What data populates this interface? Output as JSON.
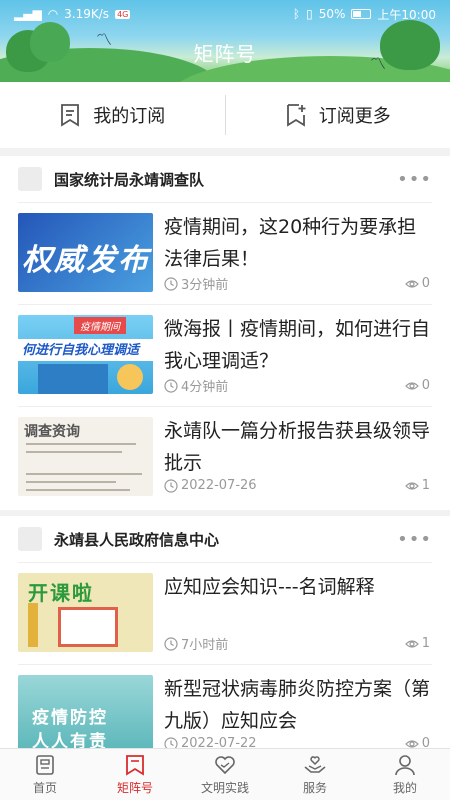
{
  "status_bar": {
    "speed": "3.19K/s",
    "net_badge": "4G",
    "battery": "50%",
    "time": "上午10:00"
  },
  "header": {
    "title": "矩阵号"
  },
  "subscribe": {
    "my_label": "我的订阅",
    "more_label": "订阅更多"
  },
  "sections": [
    {
      "title": "国家统计局永靖调查队",
      "items": [
        {
          "title": "疫情期间，这20种行为要承担法律后果！",
          "time": "3分钟前",
          "views": "0",
          "thumb_text": "权威发布"
        },
        {
          "title": "微海报丨疫情期间，如何进行自我心理调适？",
          "time": "4分钟前",
          "views": "0",
          "thumb_tag": "疫情期间",
          "thumb_text": "何进行自我心理调适"
        },
        {
          "title": "永靖队一篇分析报告获县级领导批示",
          "time": "2022-07-26",
          "views": "1",
          "thumb_text": "调查资询"
        }
      ]
    },
    {
      "title": "永靖县人民政府信息中心",
      "items": [
        {
          "title": "应知应会知识---名词解释",
          "time": "7小时前",
          "views": "1",
          "thumb_text": "开课啦"
        },
        {
          "title": "新型冠状病毒肺炎防控方案（第九版）应知应会",
          "time": "2022-07-22",
          "views": "0",
          "thumb_text_1": "疫情防控",
          "thumb_text_2": "人人有责"
        }
      ]
    }
  ],
  "nav": [
    {
      "label": "首页",
      "icon": "home-icon"
    },
    {
      "label": "矩阵号",
      "icon": "bookmark-icon"
    },
    {
      "label": "文明实践",
      "icon": "heart-icon"
    },
    {
      "label": "服务",
      "icon": "hands-heart-icon"
    },
    {
      "label": "我的",
      "icon": "person-icon"
    }
  ],
  "colors": {
    "accent": "#d92c2c",
    "muted": "#999999"
  }
}
